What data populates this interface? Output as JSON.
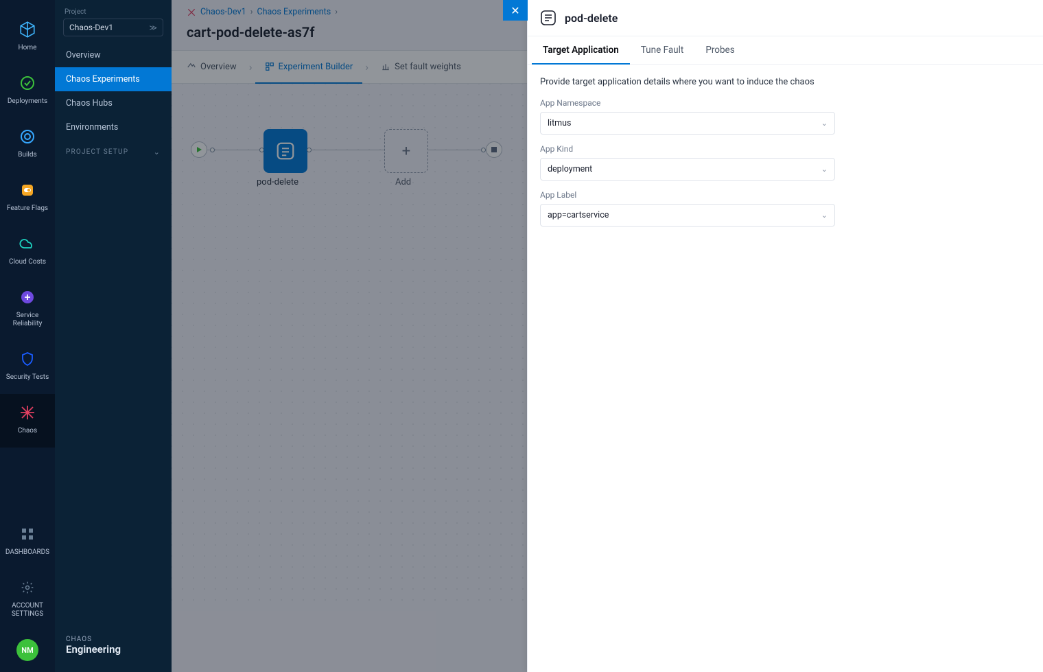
{
  "rail": {
    "items": [
      {
        "label": "Home"
      },
      {
        "label": "Deployments"
      },
      {
        "label": "Builds"
      },
      {
        "label": "Feature Flags"
      },
      {
        "label": "Cloud Costs"
      },
      {
        "label": "Service Reliability"
      },
      {
        "label": "Security Tests"
      },
      {
        "label": "Chaos"
      }
    ],
    "bottom": [
      {
        "label": "DASHBOARDS"
      },
      {
        "label": "ACCOUNT SETTINGS"
      }
    ],
    "avatar": "NM"
  },
  "sidebar": {
    "project_label": "Project",
    "project_name": "Chaos-Dev1",
    "items": [
      {
        "label": "Overview"
      },
      {
        "label": "Chaos Experiments"
      },
      {
        "label": "Chaos Hubs"
      },
      {
        "label": "Environments"
      }
    ],
    "project_setup": "PROJECT SETUP",
    "footer_sub": "CHAOS",
    "footer_main": "Engineering"
  },
  "main": {
    "breadcrumbs": [
      {
        "label": "Chaos-Dev1"
      },
      {
        "label": "Chaos Experiments"
      }
    ],
    "title": "cart-pod-delete-as7f",
    "tabs": [
      {
        "label": "Overview"
      },
      {
        "label": "Experiment Builder"
      },
      {
        "label": "Set fault weights"
      }
    ],
    "node_label": "pod-delete",
    "add_label": "Add"
  },
  "panel": {
    "title": "pod-delete",
    "tabs": [
      {
        "label": "Target Application"
      },
      {
        "label": "Tune Fault"
      },
      {
        "label": "Probes"
      }
    ],
    "description": "Provide target application details where you want to induce the chaos",
    "fields": [
      {
        "label": "App Namespace",
        "value": "litmus"
      },
      {
        "label": "App Kind",
        "value": "deployment"
      },
      {
        "label": "App Label",
        "value": "app=cartservice"
      }
    ]
  }
}
